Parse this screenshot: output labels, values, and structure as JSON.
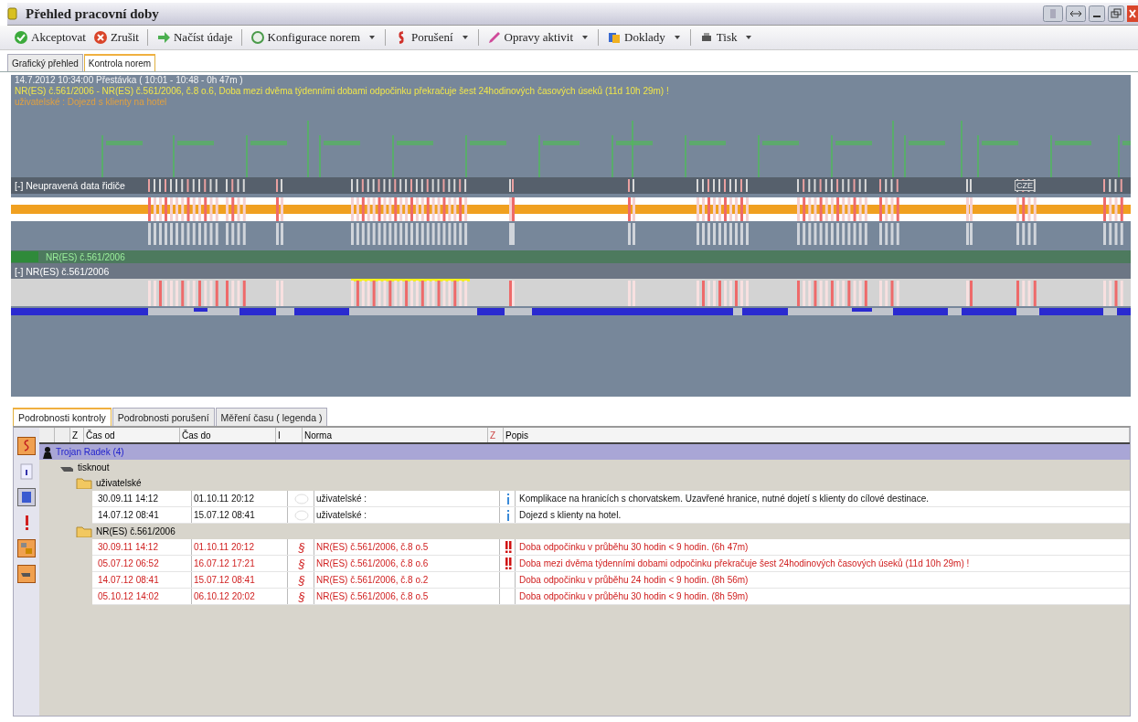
{
  "window": {
    "title": "Přehled pracovní doby"
  },
  "toolbar": [
    {
      "label": "Akceptovat",
      "kind": "accept",
      "dropdown": false
    },
    {
      "label": "Zrušit",
      "kind": "cancel",
      "dropdown": false
    },
    {
      "label": "Načíst údaje",
      "kind": "load",
      "dropdown": false
    },
    {
      "label": "Konfigurace norem",
      "kind": "config",
      "dropdown": true
    },
    {
      "label": "Porušení",
      "kind": "violation",
      "dropdown": true
    },
    {
      "label": "Opravy aktivit",
      "kind": "fix",
      "dropdown": true
    },
    {
      "label": "Doklady",
      "kind": "docs",
      "dropdown": true
    },
    {
      "label": "Tisk",
      "kind": "print",
      "dropdown": true
    }
  ],
  "tabs": [
    {
      "label": "Grafický přehled",
      "selected": false
    },
    {
      "label": "Kontrola norem",
      "selected": true
    }
  ],
  "timeline": {
    "info_lines": [
      {
        "text": "14.7.2012 10:34:00 Přestávka ( 10:01 - 10:48 - 0h 47m )",
        "kind": "info"
      },
      {
        "text": "NR(ES) č.561/2006 - NR(ES) č.561/2006, č.8 o.6, Doba mezi dvěma týdenními dobami odpočinku překračuje šest 24hodinových časových úseků (11d 10h 29m) !",
        "kind": "violation"
      },
      {
        "text": "uživatelské : Dojezd s klienty na hotel",
        "kind": "user"
      }
    ],
    "driver_track": "[-] Neupravená data řidiče",
    "country": "CZE",
    "norm_band": "NR(ES) č.561/2006",
    "norm_track": "[-] NR(ES) č.561/2006"
  },
  "detail_tabs": [
    {
      "label": "Podrobnosti kontroly",
      "selected": true
    },
    {
      "label": "Podrobnosti porušení",
      "selected": false
    },
    {
      "label": "Měření času ( legenda )",
      "selected": false
    }
  ],
  "table": {
    "columns": [
      "Z",
      "Čas od",
      "Čas do",
      "I",
      "Norma",
      "Z",
      "Popis"
    ],
    "driver": "Trojan Radek (4)",
    "print_node": "tisknout",
    "groups": [
      {
        "name": "uživatelské",
        "rows": [
          {
            "from": "30.09.11 14:12",
            "to": "01.10.11 20:12",
            "norm": "uživatelské :",
            "description": "Komplikace na hranicích s chorvatskem. Uzavřené hranice, nutné dojetí s klienty do cílové destinace.",
            "kind": "user",
            "critical": false
          },
          {
            "from": "14.07.12 08:41",
            "to": "15.07.12 08:41",
            "norm": "uživatelské :",
            "description": "Dojezd s klienty na hotel.",
            "kind": "user",
            "critical": false
          }
        ]
      },
      {
        "name": "NR(ES) č.561/2006",
        "rows": [
          {
            "from": "30.09.11 14:12",
            "to": "01.10.11 20:12",
            "mark": "§",
            "norm": "NR(ES) č.561/2006, č.8 o.5",
            "description": "Doba odpočinku v průběhu 30 hodin < 9 hodin. (6h 47m)",
            "kind": "violation",
            "critical": true
          },
          {
            "from": "05.07.12 06:52",
            "to": "16.07.12 17:21",
            "mark": "§",
            "norm": "NR(ES) č.561/2006, č.8 o.6",
            "description": "Doba mezi dvěma týdenními dobami odpočinku překračuje šest 24hodinových časových úseků (11d 10h 29m) !",
            "kind": "violation",
            "critical": true
          },
          {
            "from": "14.07.12 08:41",
            "to": "15.07.12 08:41",
            "mark": "§",
            "norm": "NR(ES) č.561/2006, č.8 o.2",
            "description": "Doba odpočinku v průběhu 24 hodin < 9 hodin. (8h 56m)",
            "kind": "violation",
            "critical": false
          },
          {
            "from": "05.10.12 14:02",
            "to": "06.10.12 20:02",
            "mark": "§",
            "norm": "NR(ES) č.561/2006, č.8 o.5",
            "description": "Doba odpočinku v průběhu 30 hodin < 9 hodin. (8h 59m)",
            "kind": "violation",
            "critical": false
          }
        ]
      }
    ]
  }
}
